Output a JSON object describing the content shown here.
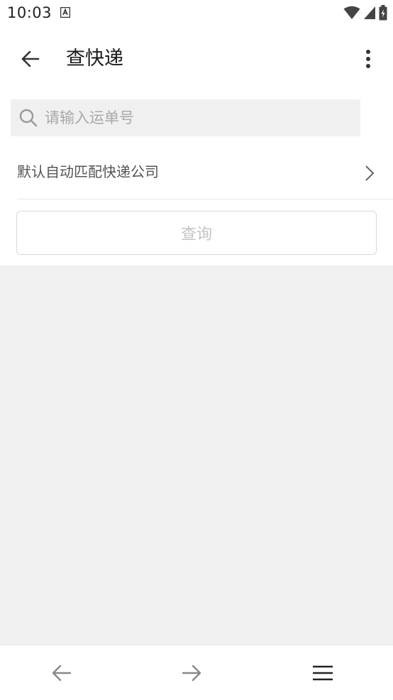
{
  "status_bar": {
    "time": "10:03",
    "icons": [
      "notification-a-icon",
      "wifi-icon",
      "signal-icon",
      "battery-charging-icon"
    ]
  },
  "app_bar": {
    "title": "查快递",
    "back_icon": "arrow-left-icon",
    "menu_icon": "more-vertical-icon"
  },
  "search": {
    "placeholder": "请输入运单号",
    "value": "",
    "icon": "search-icon"
  },
  "company_select": {
    "label": "默认自动匹配快递公司",
    "icon": "chevron-right-icon"
  },
  "query_button": {
    "label": "查询"
  },
  "bottom_nav": {
    "items": [
      "back-arrow-icon",
      "forward-arrow-icon",
      "menu-icon"
    ]
  },
  "colors": {
    "content_background": "#f1f1f1",
    "search_background": "#f0f0f0",
    "disabled_text": "#c4c4c4"
  }
}
